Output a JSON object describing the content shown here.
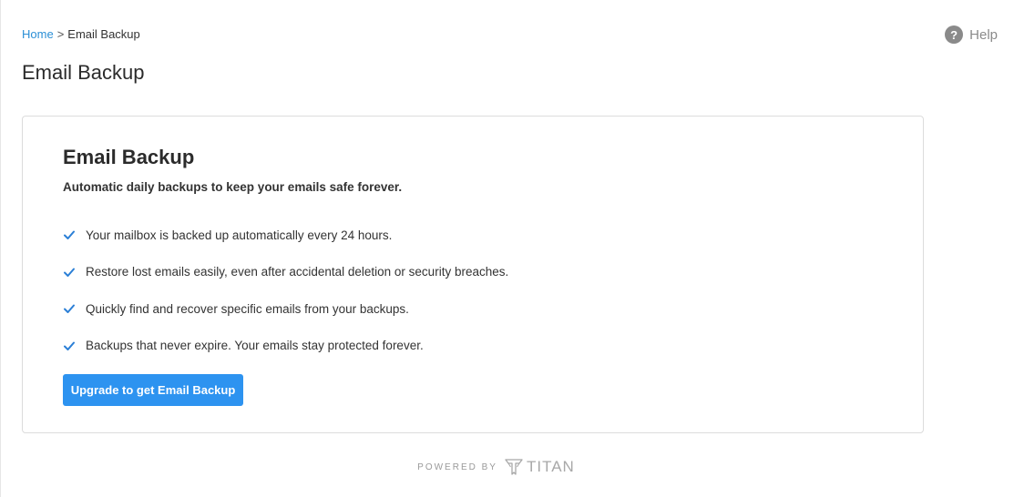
{
  "breadcrumb": {
    "home": "Home",
    "separator": ">",
    "current": "Email Backup"
  },
  "help": {
    "icon": "question-icon",
    "label": "Help"
  },
  "page": {
    "title": "Email Backup"
  },
  "card": {
    "title": "Email Backup",
    "subtitle": "Automatic daily backups to keep your emails safe forever.",
    "features": [
      "Your mailbox is backed up automatically every 24 hours.",
      "Restore lost emails easily, even after accidental deletion or security breaches.",
      "Quickly find and recover specific emails from your backups.",
      "Backups that never expire. Your emails stay protected forever."
    ],
    "button_label": "Upgrade to get Email Backup"
  },
  "footer": {
    "powered_by": "POWERED BY",
    "brand": "TITAN"
  },
  "colors": {
    "accent": "#2d93f0",
    "link": "#2b8fd6",
    "check": "#2b7fd6"
  }
}
